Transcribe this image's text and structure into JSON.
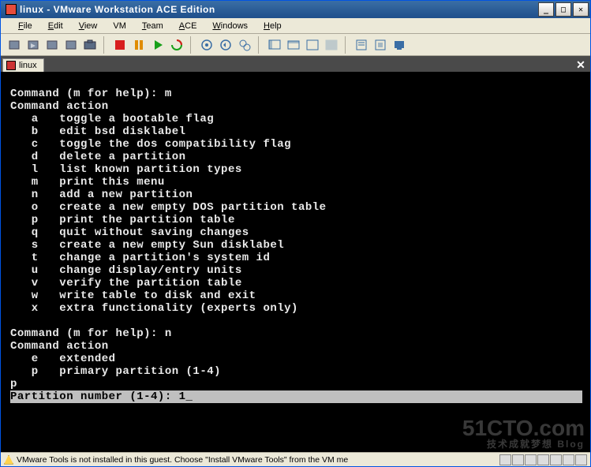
{
  "window": {
    "title": "linux - VMware Workstation ACE Edition"
  },
  "menu": {
    "file": {
      "u": "F",
      "rest": "ile"
    },
    "edit": {
      "u": "E",
      "rest": "dit"
    },
    "view": {
      "u": "V",
      "rest": "iew"
    },
    "vm": {
      "u": "",
      "rest": "VM"
    },
    "team": {
      "u": "T",
      "rest": "eam"
    },
    "ace": {
      "u": "A",
      "rest": "CE"
    },
    "windows": {
      "u": "W",
      "rest": "indows"
    },
    "help": {
      "u": "H",
      "rest": "elp"
    }
  },
  "tab": {
    "label": "linux"
  },
  "terminal": {
    "prompt1": "Command (m for help): m",
    "ca_header": "Command action",
    "actions": [
      {
        "k": "a",
        "d": "toggle a bootable flag"
      },
      {
        "k": "b",
        "d": "edit bsd disklabel"
      },
      {
        "k": "c",
        "d": "toggle the dos compatibility flag"
      },
      {
        "k": "d",
        "d": "delete a partition"
      },
      {
        "k": "l",
        "d": "list known partition types"
      },
      {
        "k": "m",
        "d": "print this menu"
      },
      {
        "k": "n",
        "d": "add a new partition"
      },
      {
        "k": "o",
        "d": "create a new empty DOS partition table"
      },
      {
        "k": "p",
        "d": "print the partition table"
      },
      {
        "k": "q",
        "d": "quit without saving changes"
      },
      {
        "k": "s",
        "d": "create a new empty Sun disklabel"
      },
      {
        "k": "t",
        "d": "change a partition's system id"
      },
      {
        "k": "u",
        "d": "change display/entry units"
      },
      {
        "k": "v",
        "d": "verify the partition table"
      },
      {
        "k": "w",
        "d": "write table to disk and exit"
      },
      {
        "k": "x",
        "d": "extra functionality (experts only)"
      }
    ],
    "prompt2": "Command (m for help): n",
    "ca_header2": "Command action",
    "actions2": [
      {
        "k": "e",
        "d": "extended"
      },
      {
        "k": "p",
        "d": "primary partition (1-4)"
      }
    ],
    "choice_p": "p",
    "hl_prompt": "Partition number (1-4): 1"
  },
  "status": {
    "message": "VMware Tools is not installed in this guest. Choose \"Install VMware Tools\" from the VM me"
  },
  "watermark": {
    "l1": "51CTO.com",
    "l2": "技术成就梦想   Blog"
  }
}
